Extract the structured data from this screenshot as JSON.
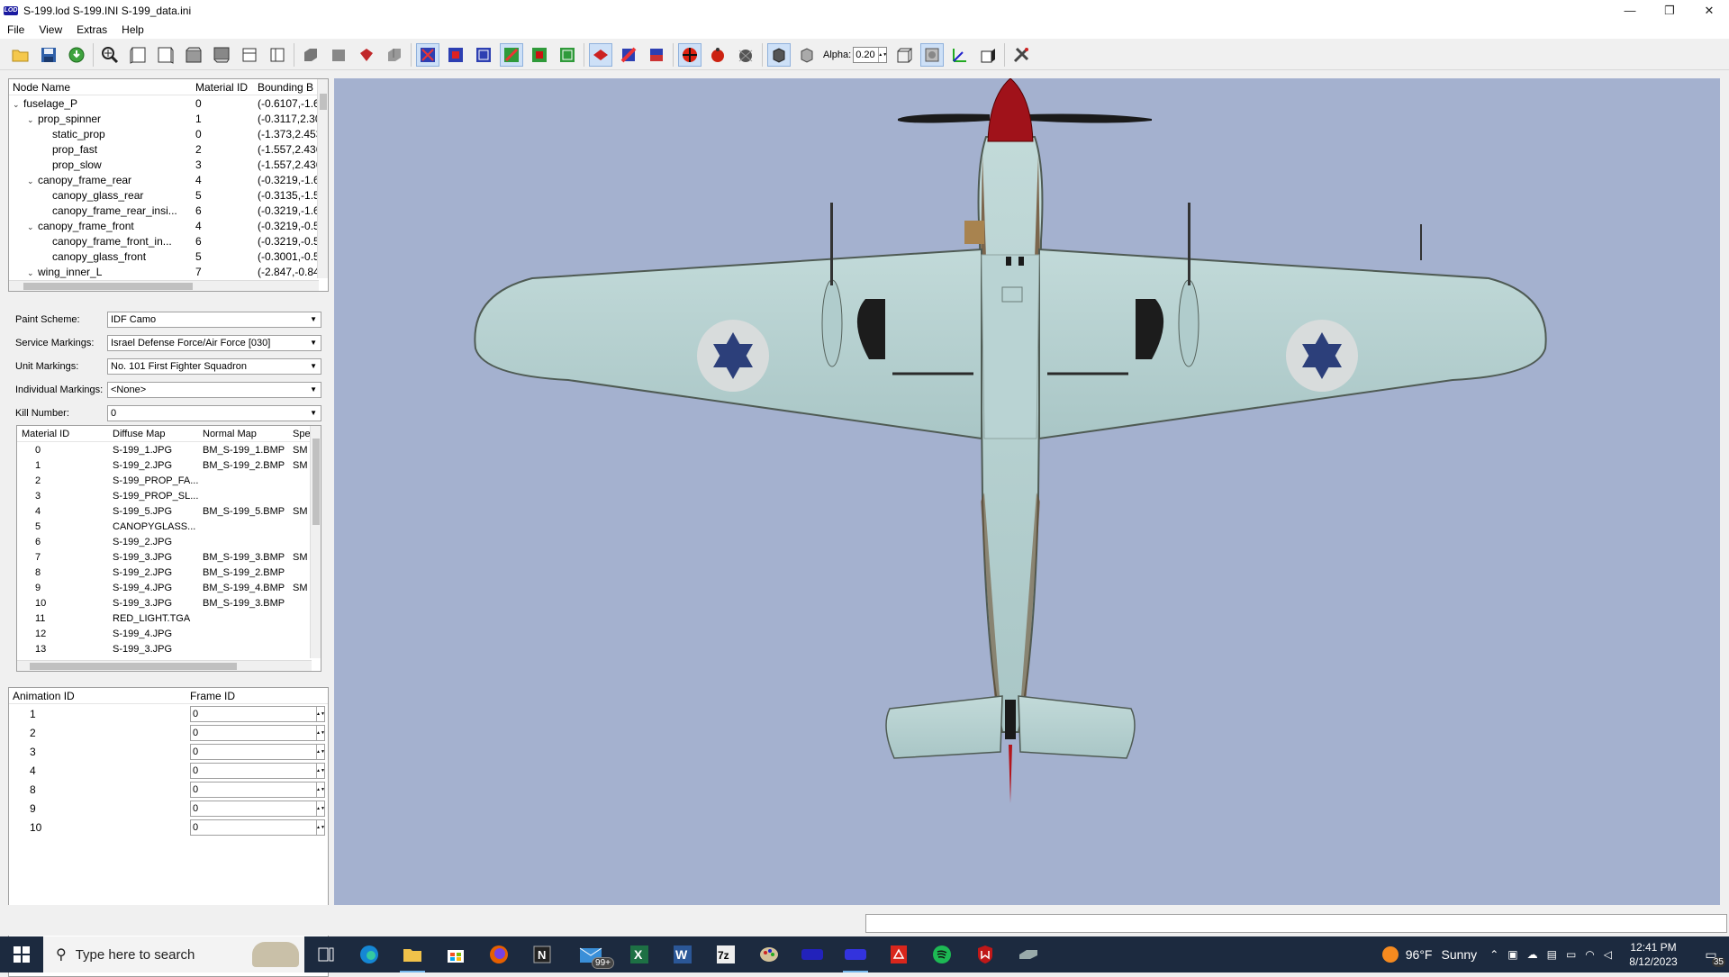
{
  "window": {
    "title": "S-199.lod  S-199.INI  S-199_data.ini",
    "logo_text": "LOD",
    "minimize": "—",
    "restore": "❐",
    "close": "✕"
  },
  "menu": [
    "File",
    "View",
    "Extras",
    "Help"
  ],
  "toolbar": {
    "alpha_label": "Alpha:",
    "alpha_value": "0.20"
  },
  "node_tree": {
    "columns": [
      "Node Name",
      "Material ID",
      "Bounding B"
    ],
    "rows": [
      {
        "name": "fuselage_P",
        "indent": 0,
        "expander": "⌄",
        "material": "0",
        "bbox": "(-0.6107,-1.6"
      },
      {
        "name": "prop_spinner",
        "indent": 1,
        "expander": "⌄",
        "material": "1",
        "bbox": "(-0.3117,2.30"
      },
      {
        "name": "static_prop",
        "indent": 2,
        "expander": "",
        "material": "0",
        "bbox": "(-1.373,2.453"
      },
      {
        "name": "prop_fast",
        "indent": 2,
        "expander": "",
        "material": "2",
        "bbox": "(-1.557,2.436"
      },
      {
        "name": "prop_slow",
        "indent": 2,
        "expander": "",
        "material": "3",
        "bbox": "(-1.557,2.436"
      },
      {
        "name": "canopy_frame_rear",
        "indent": 1,
        "expander": "⌄",
        "material": "4",
        "bbox": "(-0.3219,-1.6"
      },
      {
        "name": "canopy_glass_rear",
        "indent": 2,
        "expander": "",
        "material": "5",
        "bbox": "(-0.3135,-1.5"
      },
      {
        "name": "canopy_frame_rear_insi...",
        "indent": 2,
        "expander": "",
        "material": "6",
        "bbox": "(-0.3219,-1.6"
      },
      {
        "name": "canopy_frame_front",
        "indent": 1,
        "expander": "⌄",
        "material": "4",
        "bbox": "(-0.3219,-0.5"
      },
      {
        "name": "canopy_frame_front_in...",
        "indent": 2,
        "expander": "",
        "material": "6",
        "bbox": "(-0.3219,-0.5"
      },
      {
        "name": "canopy_glass_front",
        "indent": 2,
        "expander": "",
        "material": "5",
        "bbox": "(-0.3001,-0.5"
      },
      {
        "name": "wing_inner_L",
        "indent": 1,
        "expander": "⌄",
        "material": "7",
        "bbox": "(-2.847,-0.84"
      }
    ]
  },
  "properties": [
    {
      "label": "Paint Scheme:",
      "value": "IDF Camo"
    },
    {
      "label": "Service Markings:",
      "value": "Israel Defense Force/Air Force [030]"
    },
    {
      "label": "Unit Markings:",
      "value": "No. 101 First Fighter Squadron"
    },
    {
      "label": "Individual Markings:",
      "value": "<None>"
    },
    {
      "label": "Kill Number:",
      "value": "0"
    }
  ],
  "materials": {
    "columns": [
      "Material ID",
      "Diffuse Map",
      "Normal Map",
      "Spe"
    ],
    "rows": [
      {
        "id": "0",
        "diffuse": "S-199_1.JPG",
        "normal": "BM_S-199_1.BMP",
        "spec": "SM"
      },
      {
        "id": "1",
        "diffuse": "S-199_2.JPG",
        "normal": "BM_S-199_2.BMP",
        "spec": "SM"
      },
      {
        "id": "2",
        "diffuse": "S-199_PROP_FA...",
        "normal": "",
        "spec": ""
      },
      {
        "id": "3",
        "diffuse": "S-199_PROP_SL...",
        "normal": "",
        "spec": ""
      },
      {
        "id": "4",
        "diffuse": "S-199_5.JPG",
        "normal": "BM_S-199_5.BMP",
        "spec": "SM"
      },
      {
        "id": "5",
        "diffuse": "CANOPYGLASS...",
        "normal": "",
        "spec": ""
      },
      {
        "id": "6",
        "diffuse": "S-199_2.JPG",
        "normal": "",
        "spec": ""
      },
      {
        "id": "7",
        "diffuse": "S-199_3.JPG",
        "normal": "BM_S-199_3.BMP",
        "spec": "SM"
      },
      {
        "id": "8",
        "diffuse": "S-199_2.JPG",
        "normal": "BM_S-199_2.BMP",
        "spec": ""
      },
      {
        "id": "9",
        "diffuse": "S-199_4.JPG",
        "normal": "BM_S-199_4.BMP",
        "spec": "SM"
      },
      {
        "id": "10",
        "diffuse": "S-199_3.JPG",
        "normal": "BM_S-199_3.BMP",
        "spec": ""
      },
      {
        "id": "11",
        "diffuse": "RED_LIGHT.TGA",
        "normal": "",
        "spec": ""
      },
      {
        "id": "12",
        "diffuse": "S-199_4.JPG",
        "normal": "",
        "spec": ""
      },
      {
        "id": "13",
        "diffuse": "S-199_3.JPG",
        "normal": "",
        "spec": ""
      }
    ]
  },
  "animations": {
    "columns": [
      "Animation ID",
      "Frame ID"
    ],
    "rows": [
      {
        "id": "1",
        "frame": "0"
      },
      {
        "id": "2",
        "frame": "0"
      },
      {
        "id": "3",
        "frame": "0"
      },
      {
        "id": "4",
        "frame": "0"
      },
      {
        "id": "8",
        "frame": "0"
      },
      {
        "id": "9",
        "frame": "0"
      },
      {
        "id": "10",
        "frame": "0"
      }
    ]
  },
  "colors": {
    "viewport_bg": "#a4b1cf",
    "aircraft_skin": "#b7d2d2",
    "roundel_star": "#2c3f7a",
    "spinner": "#a0121a",
    "taskbar": "#1c2a3f"
  },
  "taskbar": {
    "search_placeholder": "Type here to search",
    "mail_badge": "99+",
    "weather_temp": "96°F",
    "weather_text": "Sunny",
    "time": "12:41 PM",
    "date": "8/12/2023",
    "notif_count": "35"
  }
}
